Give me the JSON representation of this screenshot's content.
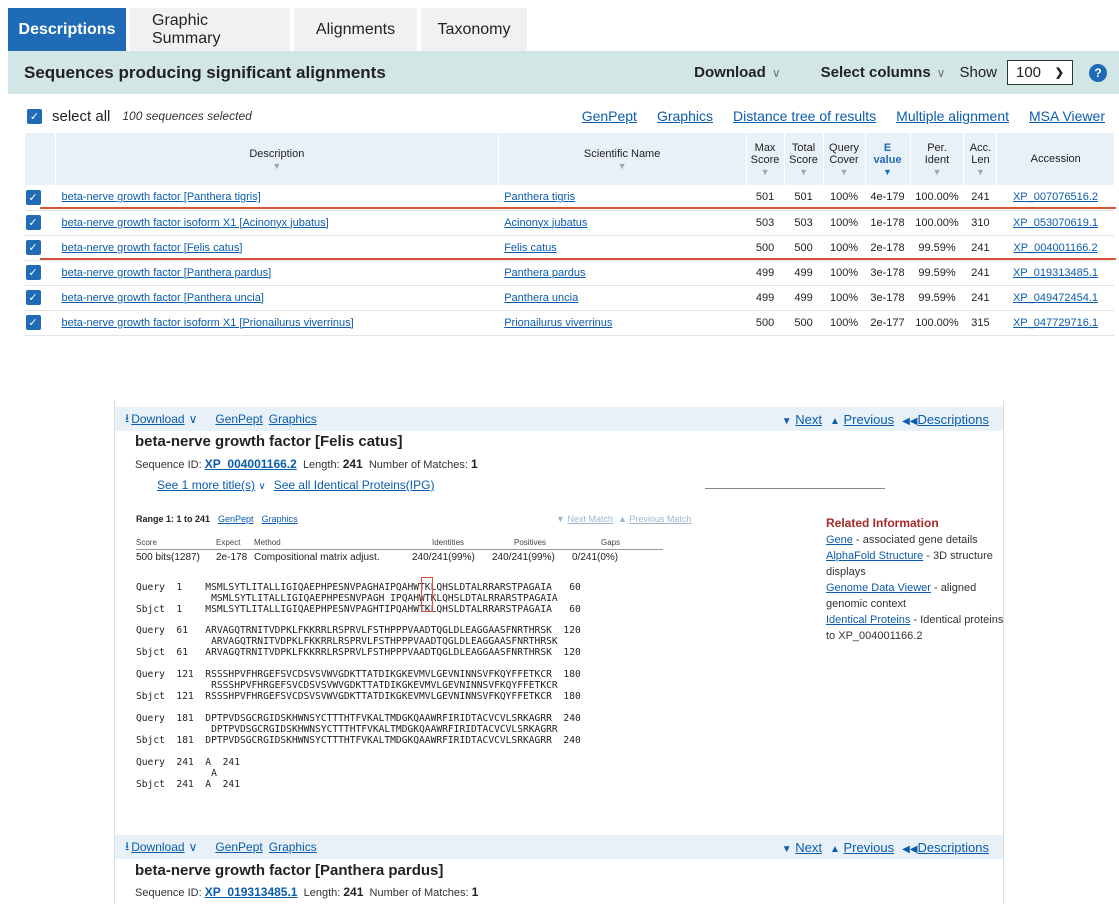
{
  "tabs": [
    {
      "label": "Descriptions",
      "active": true
    },
    {
      "label": "Graphic Summary"
    },
    {
      "label": "Alignments"
    },
    {
      "label": "Taxonomy"
    }
  ],
  "header": {
    "title": "Sequences producing significant alignments",
    "download": "Download",
    "select_columns": "Select columns",
    "show": "Show",
    "show_value": "100",
    "help": "?"
  },
  "selection": {
    "select_all": "select all",
    "count": "100 sequences selected",
    "links": [
      "GenPept",
      "Graphics",
      "Distance tree of results",
      "Multiple alignment",
      "MSA Viewer"
    ]
  },
  "table": {
    "columns": {
      "description": "Description",
      "scientific_name": "Scientific Name",
      "max_score": [
        "Max",
        "Score"
      ],
      "total_score": [
        "Total",
        "Score"
      ],
      "query_cover": [
        "Query",
        "Cover"
      ],
      "evalue": [
        "E",
        "value"
      ],
      "per_ident": [
        "Per.",
        "Ident"
      ],
      "acc_len": [
        "Acc.",
        "Len"
      ],
      "accession": "Accession"
    },
    "rows": [
      {
        "desc": "beta-nerve growth factor [Panthera tigris]",
        "sci": "Panthera tigris",
        "max": "501",
        "total": "501",
        "cover": "100%",
        "e": "4e-179",
        "ident": "100.00%",
        "len": "241",
        "acc": "XP_007076516.2"
      },
      {
        "desc": "beta-nerve growth factor isoform X1 [Acinonyx jubatus]",
        "sci": "Acinonyx jubatus",
        "max": "503",
        "total": "503",
        "cover": "100%",
        "e": "1e-178",
        "ident": "100.00%",
        "len": "310",
        "acc": "XP_053070619.1"
      },
      {
        "desc": "beta-nerve growth factor [Felis catus]",
        "sci": "Felis catus",
        "max": "500",
        "total": "500",
        "cover": "100%",
        "e": "2e-178",
        "ident": "99.59%",
        "len": "241",
        "acc": "XP_004001166.2"
      },
      {
        "desc": "beta-nerve growth factor [Panthera pardus]",
        "sci": "Panthera pardus",
        "max": "499",
        "total": "499",
        "cover": "100%",
        "e": "3e-178",
        "ident": "99.59%",
        "len": "241",
        "acc": "XP_019313485.1"
      },
      {
        "desc": "beta-nerve growth factor [Panthera uncia]",
        "sci": "Panthera uncia",
        "max": "499",
        "total": "499",
        "cover": "100%",
        "e": "3e-178",
        "ident": "99.59%",
        "len": "241",
        "acc": "XP_049472454.1"
      },
      {
        "desc": "beta-nerve growth factor isoform X1 [Prionailurus viverrinus]",
        "sci": "Prionailurus viverrinus",
        "max": "500",
        "total": "500",
        "cover": "100%",
        "e": "2e-177",
        "ident": "100.00%",
        "len": "315",
        "acc": "XP_047729716.1"
      }
    ]
  },
  "alignment_bar": {
    "download": "Download",
    "genpept": "GenPept",
    "graphics": "Graphics",
    "next": "Next",
    "previous": "Previous",
    "descriptions": "Descriptions"
  },
  "hit1": {
    "title": "beta-nerve growth factor [Felis catus]",
    "seqid_label": "Sequence ID:",
    "seqid": "XP_004001166.2",
    "length_label": "Length:",
    "length": "241",
    "matches_label": "Number of Matches:",
    "matches": "1",
    "see_more": "See 1 more title(s)",
    "see_identical": "See all Identical Proteins(IPG)",
    "range": "Range 1: 1 to 241",
    "range_genpept": "GenPept",
    "range_graphics": "Graphics",
    "next_match": "Next Match",
    "previous_match": "Previous Match",
    "score_headers": {
      "score": "Score",
      "expect": "Expect",
      "method": "Method",
      "identities": "Identities",
      "positives": "Positives",
      "gaps": "Gaps"
    },
    "score_values": {
      "score": "500 bits(1287)",
      "expect": "2e-178",
      "method": "Compositional matrix adjust.",
      "identities": "240/241(99%)",
      "positives": "240/241(99%)",
      "gaps": "0/241(0%)"
    },
    "alignment_blocks": [
      "Query  1    MSMLSYTLITALLIGIQAEPHPESNVPAGHAIPQAHWTKLQHSLDTALRRARSTPAGAIA   60\n             MSMLSYTLITALLIGIQAEPHPESNVPAGH IPQAHWTKLQHSLDTALRRARSTPAGAIA\nSbjct  1    MSMLSYTLITALLIGIQAEPHPESNVPAGHTIPQAHWTKLQHSLDTALRRARSTPAGAIA   60",
      "Query  61   ARVAGQTRNITVDPKLFKKRRLRSPRVLFSTHPPPVAADTQGLDLEAGGAASFNRTHRSK  120\n             ARVAGQTRNITVDPKLFKKRRLRSPRVLFSTHPPPVAADTQGLDLEAGGAASFNRTHRSK\nSbjct  61   ARVAGQTRNITVDPKLFKKRRLRSPRVLFSTHPPPVAADTQGLDLEAGGAASFNRTHRSK  120",
      "Query  121  RSSSHPVFHRGEFSVCDSVSVWVGDKTTATDIKGKEVMVLGEVNINNSVFKQYFFETKCR  180\n             RSSSHPVFHRGEFSVCDSVSVWVGDKTTATDIKGKEVMVLGEVNINNSVFKQYFFETKCR\nSbjct  121  RSSSHPVFHRGEFSVCDSVSVWVGDKTTATDIKGKEVMVLGEVNINNSVFKQYFFETKCR  180",
      "Query  181  DPTPVDSGCRGIDSKHWNSYCTTTHTFVKALTMDGKQAAWRFIRIDTACVCVLSRKAGRR  240\n             DPTPVDSGCRGIDSKHWNSYCTTTHTFVKALTMDGKQAAWRFIRIDTACVCVLSRKAGRR\nSbjct  181  DPTPVDSGCRGIDSKHWNSYCTTTHTFVKALTMDGKQAAWRFIRIDTACVCVLSRKAGRR  240",
      "Query  241  A  241\n             A\nSbjct  241  A  241"
    ]
  },
  "related": {
    "title": "Related Information",
    "gene": "Gene",
    "gene_desc": " - associated gene details",
    "alphafold": "AlphaFold Structure",
    "alphafold_desc": " - 3D structure displays",
    "genome": "Genome Data Viewer",
    "genome_desc": " - aligned genomic context",
    "identical": "Identical Proteins",
    "identical_desc": " - Identical proteins to XP_004001166.2"
  },
  "hit2": {
    "title": "beta-nerve growth factor [Panthera pardus]",
    "seqid_label": "Sequence ID:",
    "seqid": "XP_019313485.1",
    "length_label": "Length:",
    "length": "241",
    "matches_label": "Number of Matches:",
    "matches": "1"
  },
  "colors": {
    "primary": "#1f6bb5",
    "teal_bar": "#d2e6e6",
    "highlight": "#d9533c",
    "link": "#0b5cad"
  }
}
